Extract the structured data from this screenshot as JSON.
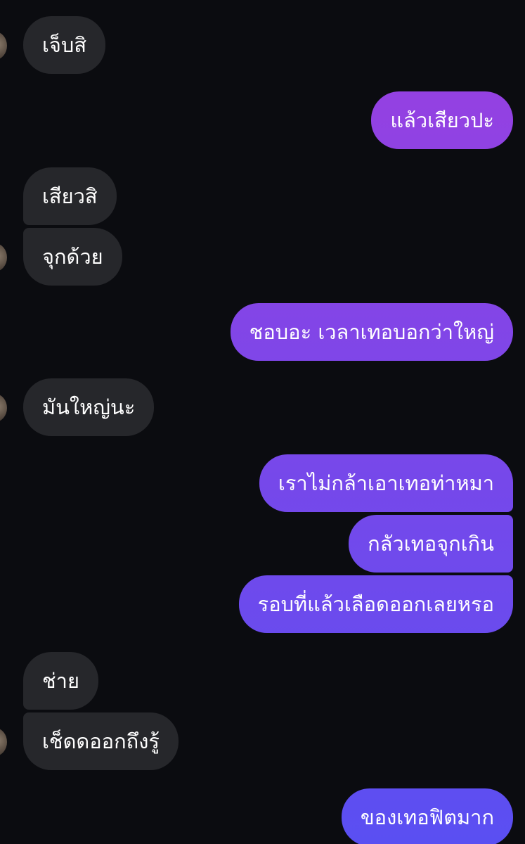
{
  "colors": {
    "background": "#0b0c10",
    "incoming_bubble": "#26272b",
    "text": "#ffffff",
    "outgoing_gradient_top": "#9b3fe0",
    "outgoing_gradient_bottom": "#5a4ff2"
  },
  "messages": [
    {
      "dir": "in",
      "text": "เจ็บสิ",
      "avatar": true
    },
    {
      "dir": "out",
      "text": "แล้วเสียวปะ"
    },
    {
      "dir": "in",
      "text": "เสียวสิ"
    },
    {
      "dir": "in",
      "text": "จุกด้วย",
      "avatar": true
    },
    {
      "dir": "out",
      "text": "ชอบอะ เวลาเทอบอกว่าใหญ่"
    },
    {
      "dir": "in",
      "text": "มันใหญ่นะ",
      "avatar": true
    },
    {
      "dir": "out",
      "text": "เราไม่กล้าเอาเทอท่าหมา"
    },
    {
      "dir": "out",
      "text": "กลัวเทอจุกเกิน"
    },
    {
      "dir": "out",
      "text": "รอบที่แล้วเลือดออกเลยหรอ"
    },
    {
      "dir": "in",
      "text": "ช่าย"
    },
    {
      "dir": "in",
      "text": "เช็ดดออกถึงรู้",
      "avatar": true
    },
    {
      "dir": "out",
      "text": "ของเทอฟิตมาก"
    }
  ]
}
